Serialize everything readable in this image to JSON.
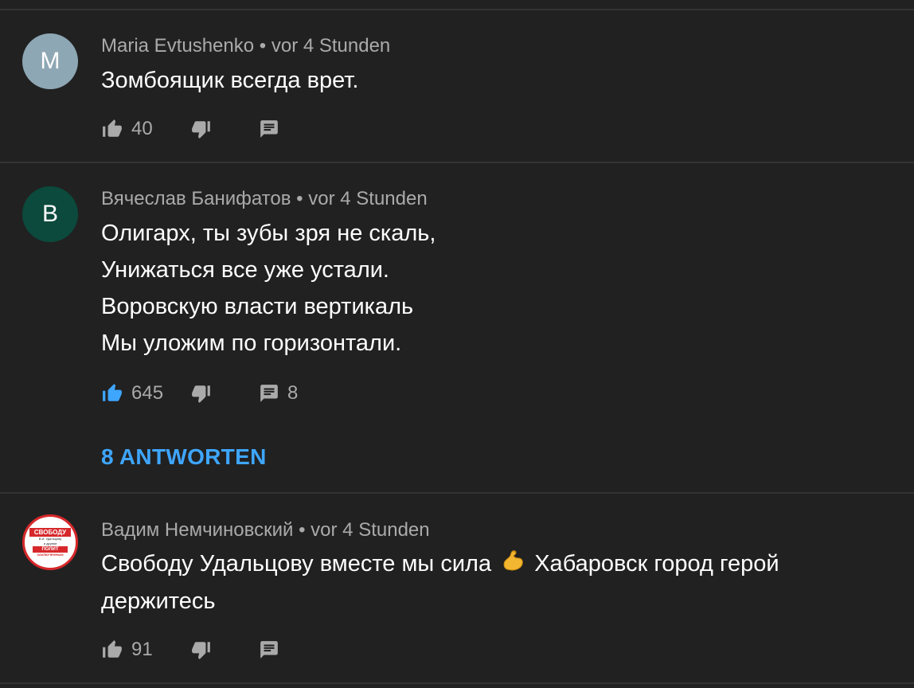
{
  "comments": [
    {
      "avatar_letter": "M",
      "avatar_color": "#8ea7b4",
      "author": "Maria Evtushenko",
      "time": "vor 4 Stunden",
      "lines": [
        "Зомбоящик всегда врет."
      ],
      "likes": "40",
      "liked": false,
      "replies_count": ""
    },
    {
      "avatar_letter": "В",
      "avatar_color": "#0b4a3c",
      "author": "Вячеслав Банифатов",
      "time": "vor 4 Stunden",
      "lines": [
        "Олигарх, ты зубы зря не скаль,",
        "Унижаться все уже устали.",
        "Воровскую власти вертикаль",
        "Мы уложим по горизонтали."
      ],
      "likes": "645",
      "liked": true,
      "replies_count": "8",
      "replies_label": "8 ANTWORTEN"
    },
    {
      "avatar_badge": {
        "line1": "СВОБОДУ",
        "line2": "В.И. Удальцову",
        "line3": "и другим",
        "line4": "ПОЛИТ",
        "line5": "ЗАКЛЮЧЕННЫМ"
      },
      "author": "Вадим Немчиновский",
      "time": "vor 4 Stunden",
      "lines": [
        "Свободу Удальцову вместе мы сила",
        "Хабаровск город герой",
        "держитесь"
      ],
      "emoji": "flexed-biceps",
      "likes": "91",
      "liked": false,
      "replies_count": ""
    }
  ],
  "colors": {
    "background": "#212121",
    "meta": "#aaaaaa",
    "accent_blue": "#3ea6ff",
    "badge_red": "#d6282b"
  }
}
